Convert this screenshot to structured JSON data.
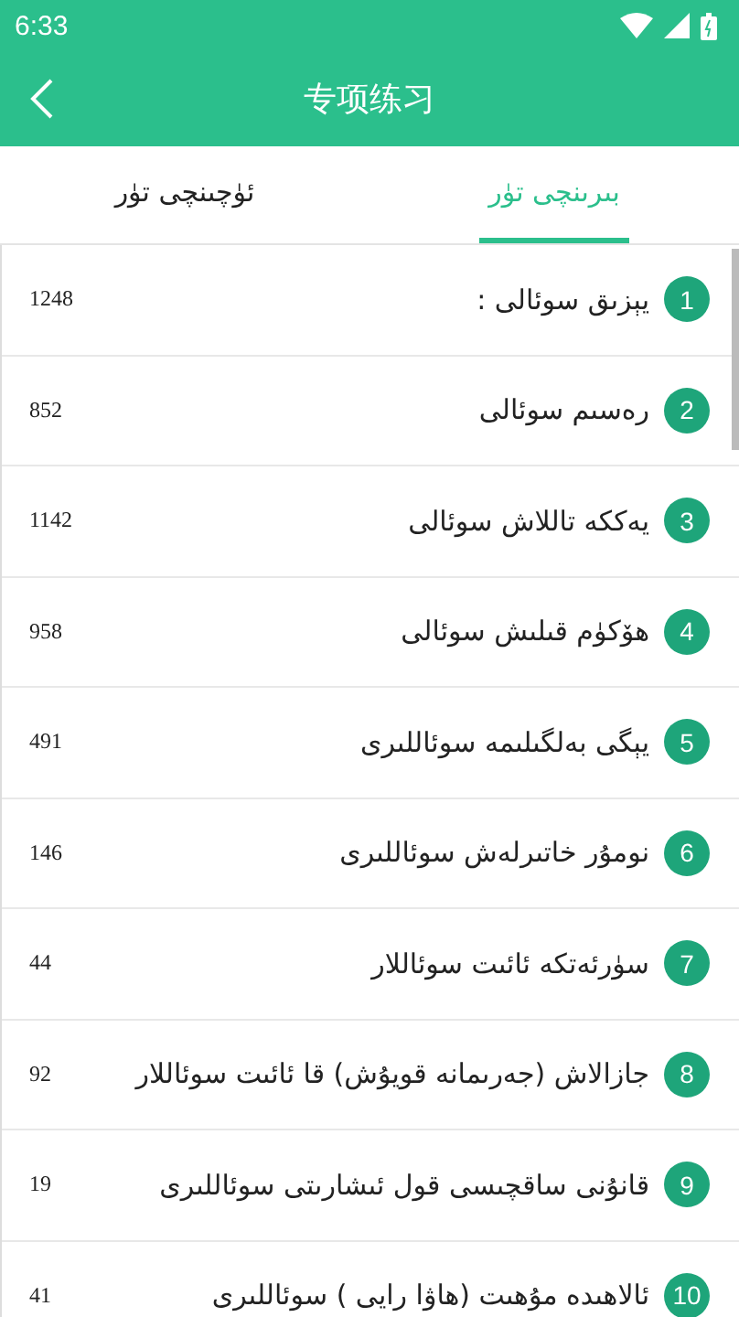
{
  "status_bar": {
    "time": "6:33"
  },
  "app_bar": {
    "title": "专项练习"
  },
  "tabs": [
    {
      "label": "بىرىنچى تۈر",
      "selected": true
    },
    {
      "label": "ئۈچىنچى تۈر",
      "selected": false
    }
  ],
  "items": [
    {
      "number": "1",
      "title": "يېزىق سوئالى :",
      "count": "1248"
    },
    {
      "number": "2",
      "title": "رەسىم سوئالى",
      "count": "852"
    },
    {
      "number": "3",
      "title": "يەككە تاللاش سوئالى",
      "count": "1142"
    },
    {
      "number": "4",
      "title": "ھۆكۈم قىلىش سوئالى",
      "count": "958"
    },
    {
      "number": "5",
      "title": "يېگى بەلگىلىمە سوئاللىرى",
      "count": "491"
    },
    {
      "number": "6",
      "title": "نومۇر خاتىرلەش سوئاللىرى",
      "count": "146"
    },
    {
      "number": "7",
      "title": "سۈرئەتكە ئائىت سوئاللار",
      "count": "44"
    },
    {
      "number": "8",
      "title": "جازالاش (جەرىمانە قويۇش) قا ئائىت سوئاللار",
      "count": "92"
    },
    {
      "number": "9",
      "title": "قانۇنى ساقچىسى قول ئىشارىتى سوئاللىرى",
      "count": "19"
    },
    {
      "number": "10",
      "title": "ئالاھىدە مۇھىت (ھاۋا رايى ) سوئاللىرى",
      "count": "41"
    }
  ]
}
